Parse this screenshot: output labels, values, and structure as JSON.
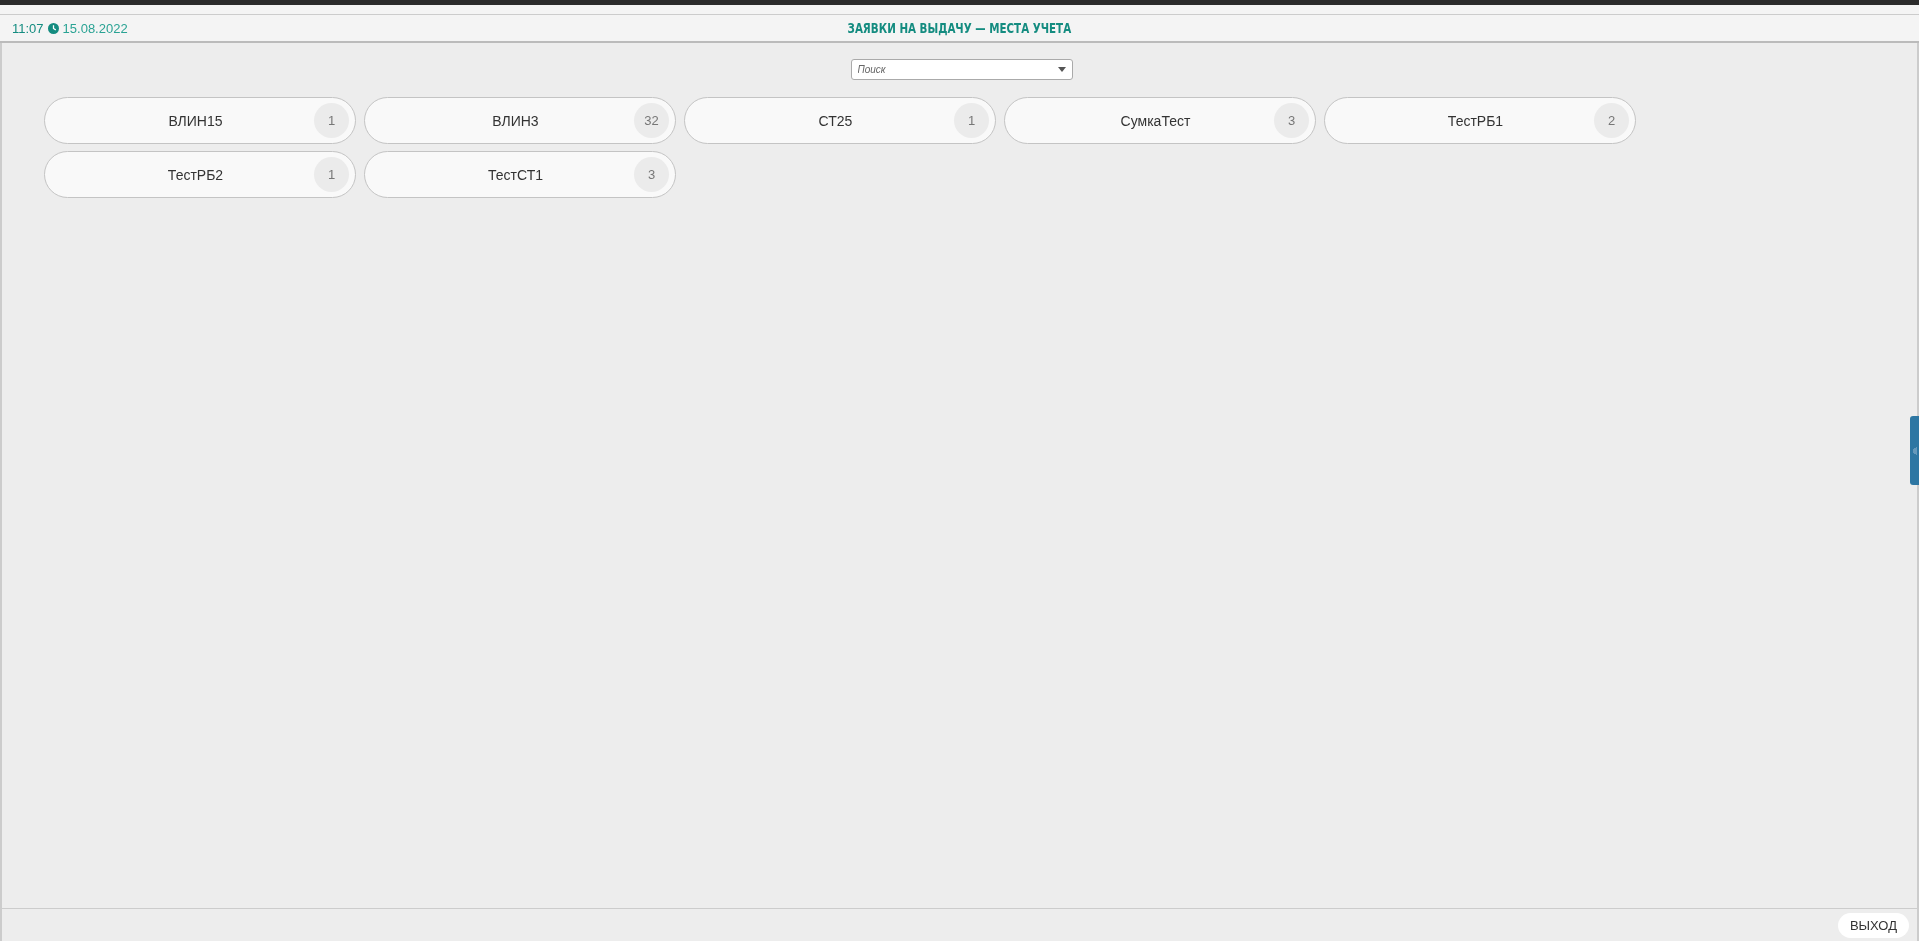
{
  "header": {
    "time": "11:07",
    "date": "15.08.2022",
    "title": "ЗАЯВКИ НА ВЫДАЧУ — МЕСТА УЧЕТА"
  },
  "search": {
    "placeholder": "Поиск"
  },
  "places": [
    {
      "name": "ВЛИН15",
      "count": "1"
    },
    {
      "name": "ВЛИН3",
      "count": "32"
    },
    {
      "name": "СТ25",
      "count": "1"
    },
    {
      "name": "СумкаТест",
      "count": "3"
    },
    {
      "name": "ТестРБ1",
      "count": "2"
    },
    {
      "name": "ТестРБ2",
      "count": "1"
    },
    {
      "name": "ТестСТ1",
      "count": "3"
    }
  ],
  "footer": {
    "exit_button": "ВЫХОД"
  }
}
